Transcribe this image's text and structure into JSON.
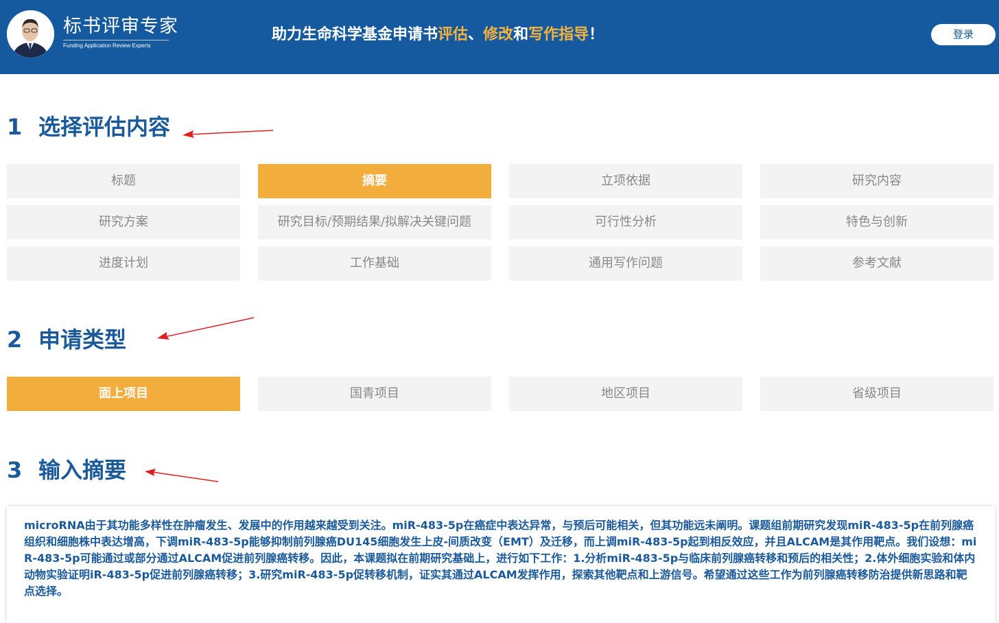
{
  "header": {
    "brand_title": "标书评审专家",
    "brand_subtitle": "Funding Application Review Experts",
    "slogan_parts": [
      "助力生命科学基金申请书",
      "评估",
      "、",
      "修改",
      "和",
      "写作指导",
      "！"
    ],
    "login_label": "登录",
    "colors": {
      "bar": "#15599f",
      "highlight": "#f5b33d"
    }
  },
  "section1": {
    "number": "1",
    "title": "选择评估内容",
    "options": [
      {
        "label": "标题",
        "active": false
      },
      {
        "label": "摘要",
        "active": true
      },
      {
        "label": "立项依据",
        "active": false
      },
      {
        "label": "研究内容",
        "active": false
      },
      {
        "label": "研究方案",
        "active": false
      },
      {
        "label": "研究目标/预期结果/拟解决关键问题",
        "active": false
      },
      {
        "label": "可行性分析",
        "active": false
      },
      {
        "label": "特色与创新",
        "active": false
      },
      {
        "label": "进度计划",
        "active": false
      },
      {
        "label": "工作基础",
        "active": false
      },
      {
        "label": "通用写作问题",
        "active": false
      },
      {
        "label": "参考文献",
        "active": false
      }
    ]
  },
  "section2": {
    "number": "2",
    "title": "申请类型",
    "options": [
      {
        "label": "面上项目",
        "active": true
      },
      {
        "label": "国青项目",
        "active": false
      },
      {
        "label": "地区项目",
        "active": false
      },
      {
        "label": "省级项目",
        "active": false
      }
    ]
  },
  "section3": {
    "number": "3",
    "title": "输入摘要",
    "abstract": "microRNA由于其功能多样性在肿瘤发生、发展中的作用越来越受到关注。miR-483-5p在癌症中表达异常，与预后可能相关，但其功能远未阐明。课题组前期研究发现miR-483-5p在前列腺癌组织和细胞株中表达增高，下调miR-483-5p能够抑制前列腺癌DU145细胞发生上皮-间质改变（EMT）及迁移，而上调miR-483-5p起到相反效应，并且ALCAM是其作用靶点。我们设想：miR-483-5p可能通过或部分通过ALCAM促进前列腺癌转移。因此，本课题拟在前期研究基础上，进行如下工作：1.分析miR-483-5p与临床前列腺癌转移和预后的相关性；2.体外细胞实验和体内动物实验证明iR-483-5p促进前列腺癌转移；3.研究miR-483-5p促转移机制，证实其通过ALCAM发挥作用，探索其他靶点和上游信号。希望通过这些工作为前列腺癌转移防治提供新思路和靶点选择。"
  },
  "colors": {
    "accent": "#f3ad3c",
    "section_title": "#1a5a9a",
    "option_bg": "#f3f3f3",
    "arrow": "#e02020"
  }
}
